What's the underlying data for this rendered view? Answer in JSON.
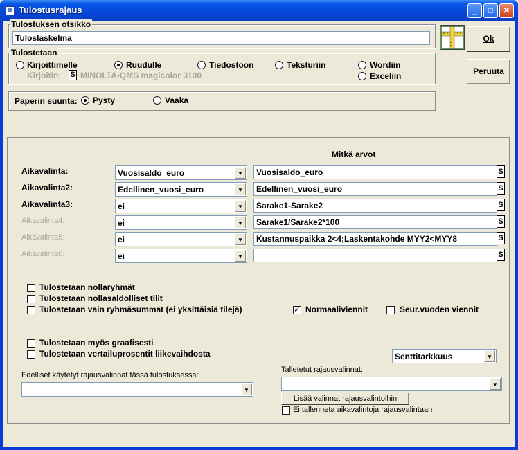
{
  "window": {
    "title": "Tulostusrajaus",
    "minimize": "_",
    "maximize": "□",
    "close": "✕"
  },
  "title_group": {
    "legend": "Tulostuksen otsikko",
    "value": "Tuloslaskelma"
  },
  "output_group": {
    "legend": "Tulostetaan",
    "options": [
      "Kirjoittimelle",
      "Ruudulle",
      "Tiedostoon",
      "Teksturiin",
      "Wordiin",
      "Exceliin"
    ],
    "selected": "Ruudulle",
    "printer_label": "Kirjoitin:",
    "printer_button": "S",
    "printer_name": "MINOLTA-QMS magicolor 3100"
  },
  "orientation_group": {
    "label": "Paperin suunta:",
    "options": [
      "Pysty",
      "Vaaka"
    ],
    "selected": "Pysty"
  },
  "buttons": {
    "ok": "Ok",
    "cancel": "Peruuta"
  },
  "criteria": {
    "header": "Mitkä arvot",
    "rows": [
      {
        "label": "Aikavalinta:",
        "combo": "Vuosisaldo_euro",
        "value": "Vuosisaldo_euro",
        "s": "S",
        "enabled": true
      },
      {
        "label": "Aikavalinta2:",
        "combo": "Edellinen_vuosi_euro",
        "value": "Edellinen_vuosi_euro",
        "s": "S",
        "enabled": true
      },
      {
        "label": "Aikavalinta3:",
        "combo": "ei",
        "value": "Sarake1-Sarake2",
        "s": "S",
        "enabled": true
      },
      {
        "label": "Aikavalinta4:",
        "combo": "ei",
        "value": "Sarake1/Sarake2*100",
        "s": "S",
        "enabled": false
      },
      {
        "label": "Aikavalinta5:",
        "combo": "ei",
        "value": "Kustannuspaikka 2<4;Laskentakohde MYY2<MYY8",
        "s": "S",
        "enabled": false
      },
      {
        "label": "Aikavalinta6:",
        "combo": "ei",
        "value": "",
        "s": "S",
        "enabled": false
      }
    ]
  },
  "checkboxes": {
    "zero_groups": {
      "label": "Tulostetaan nollaryhmät",
      "checked": false
    },
    "zero_accounts": {
      "label": "Tulostetaan nollasaldolliset tilit",
      "checked": false
    },
    "group_sums_only": {
      "label": "Tulostetaan vain ryhmäsummat (ei yksittäisiä tilejä)",
      "checked": false
    },
    "normal_entries": {
      "label": "Normaaliviennit",
      "checked": true
    },
    "next_year_entries": {
      "label": "Seur.vuoden viennit",
      "checked": false
    },
    "graphical": {
      "label": "Tulostetaan myös graafisesti",
      "checked": false
    },
    "comparison_percent": {
      "label": "Tulostetaan vertailuprosentit liikevaihdosta",
      "checked": false
    }
  },
  "precision": {
    "value": "Senttitarkkuus"
  },
  "previous": {
    "label": "Edelliset käytetyt rajausvalinnat tässä tulostuksessa:",
    "value": ""
  },
  "saved": {
    "label": "Talletetut rajausvalinnat:",
    "value": "",
    "add_button": "Lisää valinnat rajausvalintoihin",
    "no_save_label": "Ei tallenneta aikavalintoja rajausvalintaan",
    "no_save_checked": false
  },
  "colors": {
    "titlebar": "#0a3bd6",
    "face": "#ece9d8",
    "disabled_text": "#a8a79d"
  }
}
